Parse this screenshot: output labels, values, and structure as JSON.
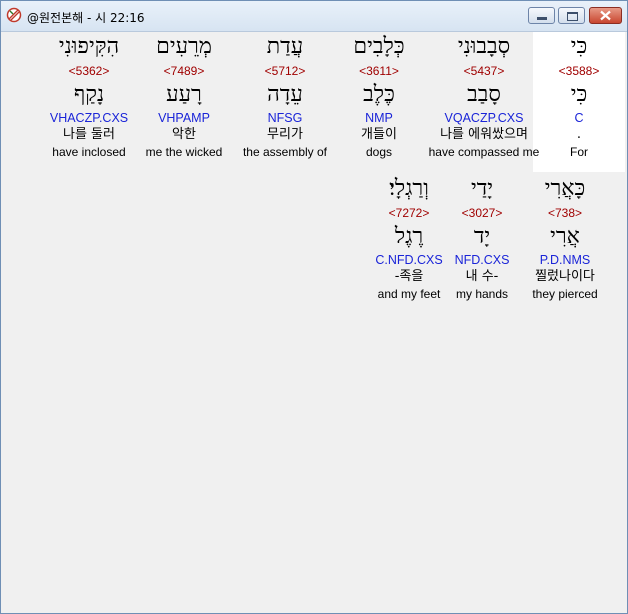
{
  "window": {
    "title": "@원전본해 - 시 22:16"
  },
  "words": [
    {
      "hebrew": "כִּי",
      "strong": "<3588>",
      "lemma": "כִּי",
      "parse": "C",
      "korean": ".",
      "english": "For",
      "selected": true
    },
    {
      "hebrew": "סְבָבוּנִי",
      "strong": "<5437>",
      "lemma": "סָבַב",
      "parse": "VQACZP.CXS",
      "korean": "나를 에워쌌으며",
      "english": "have compassed me",
      "selected": false
    },
    {
      "hebrew": "כְּלָבִים",
      "strong": "<3611>",
      "lemma": "כֶּלֶב",
      "parse": "NMP",
      "korean": "개들이",
      "english": "dogs",
      "selected": false
    },
    {
      "hebrew": "עֲדַת",
      "strong": "<5712>",
      "lemma": "עֵדָה",
      "parse": "NFSG",
      "korean": "무리가",
      "english": "the assembly of",
      "selected": false
    },
    {
      "hebrew": "מְרֵעִים",
      "strong": "<7489>",
      "lemma": "רָעַע",
      "parse": "VHPAMP",
      "korean": "악한",
      "english": "me the wicked",
      "selected": false
    },
    {
      "hebrew": "הִקִּיפוּנִי",
      "strong": "<5362>",
      "lemma": "נָקַף",
      "parse": "VHACZP.CXS",
      "korean": "나를 둘러",
      "english": "have inclosed",
      "selected": false
    },
    {
      "hebrew": "כָּאֲרִי",
      "strong": "<738>",
      "lemma": "אֲרִי",
      "parse": "P.D.NMS",
      "korean": "찔렀나이다",
      "english": "they pierced",
      "selected": false
    },
    {
      "hebrew": "יָדַי",
      "strong": "<3027>",
      "lemma": "יָד",
      "parse": "NFD.CXS",
      "korean": "내 수-",
      "english": "my hands",
      "selected": false
    },
    {
      "hebrew": "וְרַגְלָי׃",
      "strong": "<7272>",
      "lemma": "רֶגֶל",
      "parse": "C.NFD.CXS",
      "korean": "-족을",
      "english": "and my feet",
      "selected": false
    }
  ]
}
